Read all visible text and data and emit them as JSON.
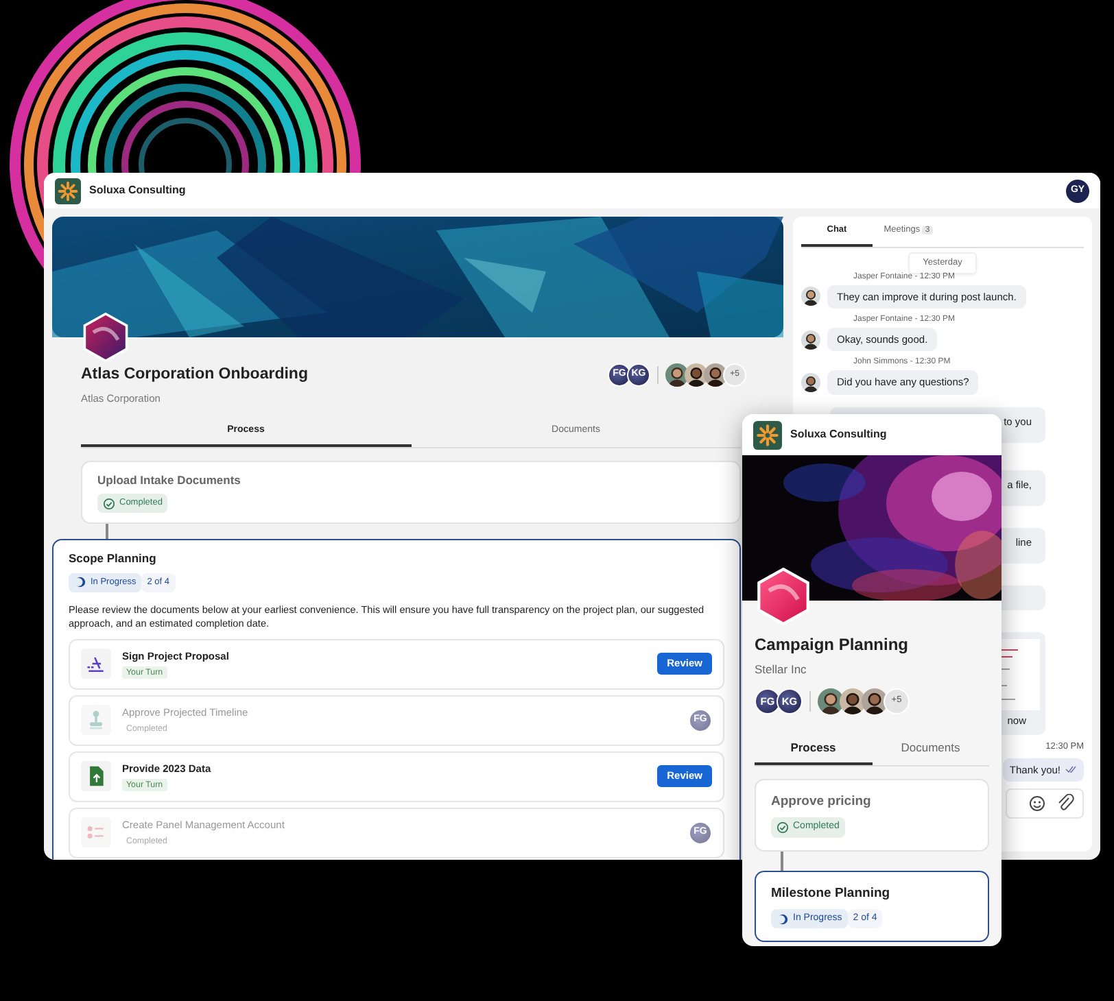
{
  "app_window": {
    "brand": "Soluxa Consulting",
    "user_initials": "GY",
    "project": {
      "title": "Atlas Corporation Onboarding",
      "client": "Atlas Corporation",
      "team_initials": [
        "FG",
        "KG"
      ],
      "more_count": "+5",
      "tabs": [
        {
          "label": "Process",
          "selected": true
        },
        {
          "label": "Documents",
          "selected": false
        }
      ],
      "stages": [
        {
          "kind": "completed",
          "title": "Upload Intake Documents",
          "status": "Completed"
        },
        {
          "kind": "in_progress",
          "title": "Scope Planning",
          "status": "In Progress",
          "progress": "2 of 4",
          "description": "Please review the documents below at your earliest convenience. This will ensure you have full transparency on the project plan, our suggested approach, and an estimated completion date.",
          "tasks": [
            {
              "title": "Sign Project Proposal",
              "status": "Your Turn",
              "done": false,
              "action": "Review"
            },
            {
              "title": "Approve Projected Timeline",
              "status": "Completed",
              "done": true,
              "assignee": "FG"
            },
            {
              "title": "Provide 2023 Data",
              "status": "Your Turn",
              "done": false,
              "action": "Review"
            },
            {
              "title": "Create Panel Management Account",
              "status": "Completed",
              "done": true,
              "assignee": "FG"
            }
          ]
        }
      ]
    },
    "chat": {
      "tabs": [
        {
          "label": "Chat",
          "selected": true
        },
        {
          "label": "Meetings",
          "count": "3",
          "selected": false
        }
      ],
      "day": "Yesterday",
      "messages": [
        {
          "kind": "received",
          "meta": "Jasper Fontaine - 12:30 PM",
          "text": "They can improve it during post launch."
        },
        {
          "kind": "received",
          "meta": "Jasper Fontaine - 12:30 PM",
          "text": "Okay, sounds good."
        },
        {
          "kind": "received",
          "meta": "John Simmons - 12:30 PM",
          "text": "Did you have any questions?"
        },
        {
          "kind": "partial",
          "text": "to you"
        },
        {
          "kind": "partial",
          "text": "a file,"
        },
        {
          "kind": "partial",
          "text": "line"
        },
        {
          "kind": "partial"
        },
        {
          "kind": "attachment",
          "text": "now"
        },
        {
          "kind": "sent",
          "meta": "12:30 PM",
          "text": "Thank you!"
        }
      ]
    }
  },
  "mobile_window": {
    "brand": "Soluxa Consulting",
    "title": "Campaign Planning",
    "client": "Stellar Inc",
    "team_initials": [
      "FG",
      "KG"
    ],
    "more_count": "+5",
    "tabs": [
      {
        "label": "Process",
        "selected": true
      },
      {
        "label": "Documents",
        "selected": false
      }
    ],
    "stages": [
      {
        "kind": "completed",
        "title": "Approve pricing",
        "status": "Completed"
      },
      {
        "kind": "in_progress",
        "title": "Milestone Planning",
        "status": "In Progress",
        "progress": "2 of 4"
      }
    ]
  }
}
